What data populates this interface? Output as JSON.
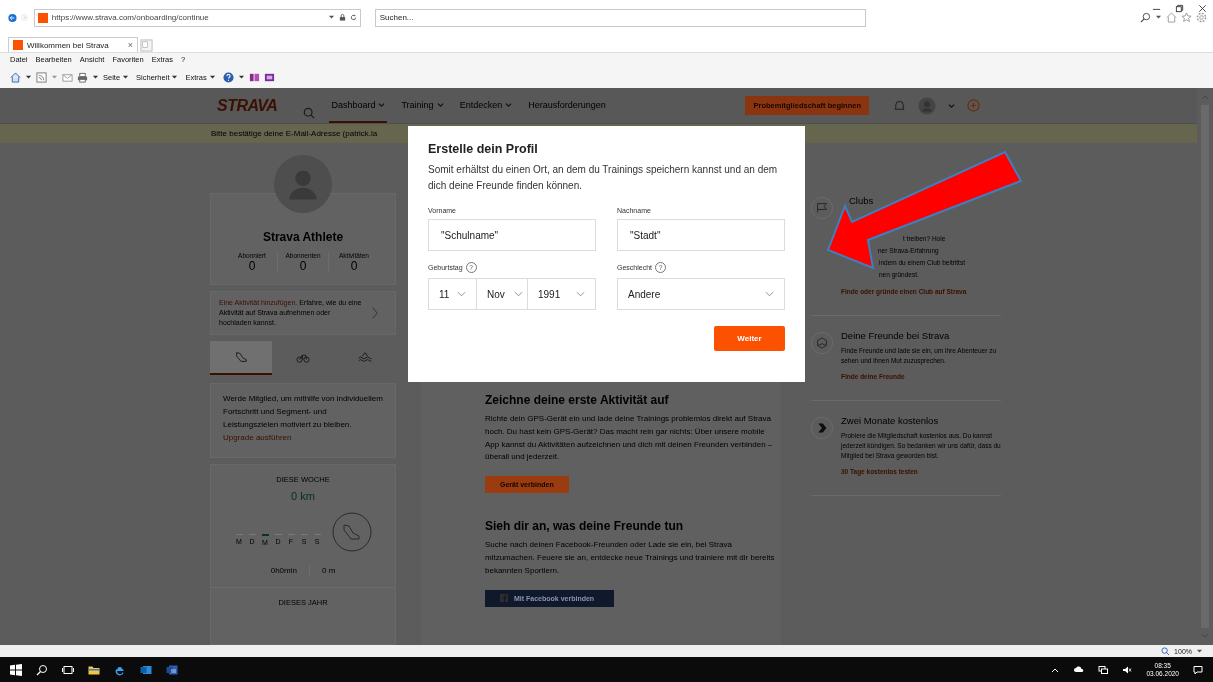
{
  "browser": {
    "address": "https://www.strava.com/onboarding/continue",
    "search_placeholder": "Suchen...",
    "tab": {
      "title": "Willkommen bei Strava",
      "close": "×"
    },
    "menu": [
      "Datei",
      "Bearbeiten",
      "Ansicht",
      "Favoriten",
      "Extras",
      "?"
    ],
    "commands": [
      "Seite",
      "Sicherheit",
      "Extras"
    ],
    "zoom": "100%"
  },
  "nav": {
    "logo": "STRAVA",
    "items": [
      {
        "label": "Dashboard",
        "has_menu": true,
        "selected": true
      },
      {
        "label": "Training",
        "has_menu": true,
        "selected": false
      },
      {
        "label": "Entdecken",
        "has_menu": true,
        "selected": false
      },
      {
        "label": "Herausforderungen",
        "has_menu": false,
        "selected": false
      }
    ],
    "trial_button": "Probemitgliedschaft beginnen"
  },
  "banner": "Bitte bestätige deine E-Mail-Adresse (patrick.la",
  "profile": {
    "name": "Strava Athlete",
    "stats": [
      {
        "label": "Abonniert",
        "value": "0"
      },
      {
        "label": "Abonnenten",
        "value": "0"
      },
      {
        "label": "Aktivitäten",
        "value": "0"
      }
    ]
  },
  "add_activity": {
    "link": "Eine Aktivität hinzufügen.",
    "text": "Erfahre, wie du eine Aktivität auf Strava aufnehmen oder hochladen kannst."
  },
  "sport_tabs": [
    {
      "kind": "run",
      "selected": true
    },
    {
      "kind": "ride",
      "selected": false
    },
    {
      "kind": "swim",
      "selected": false
    }
  ],
  "membership": {
    "text": "Werde Mitglied, um mithilfe von individuellem Fortschritt und Segment- und Leistungszielen motiviert zu bleiben.",
    "link": "Upgrade ausführen"
  },
  "week": {
    "heading": "DIESE WOCHE",
    "distance": "0 km",
    "days": [
      {
        "label": "M",
        "selected": false
      },
      {
        "label": "D",
        "selected": false
      },
      {
        "label": "M",
        "selected": true
      },
      {
        "label": "D",
        "selected": false
      },
      {
        "label": "F",
        "selected": false
      },
      {
        "label": "S",
        "selected": false
      },
      {
        "label": "S",
        "selected": false
      }
    ],
    "time": "0h0min",
    "elevation": "0 m",
    "year_heading": "DIESES JAHR"
  },
  "center": [
    {
      "title": "Zeichne deine erste Aktivität auf",
      "text": "Richte dein GPS-Gerät ein und lade deine Trainings problemlos direkt auf Strava hoch. Du hast kein GPS-Gerät? Das macht rein gar nichts: Über unsere mobile App kannst du Aktivitäten aufzeichnen und dich mit deinen Freunden verbinden – überall und jederzeit.",
      "button": {
        "kind": "device",
        "label": "Gerät verbinden"
      }
    },
    {
      "title": "Sieh dir an, was deine Freunde tun",
      "text": "Suche nach deinen Facebook-Freunden oder Lade sie ein, bei Strava mitzumachen. Feuere sie an, entdecke neue Trainings und trainiere mit dir bereits bekannten Sportlern.",
      "button": {
        "kind": "facebook",
        "label": "Mit Facebook verbinden"
      }
    }
  ],
  "right": [
    {
      "kind": "flag",
      "title": "Clubs",
      "lines": [
        "t treiben? Hole",
        "ner Strava-Erfahrung",
        "indem du einem Club beitrittst",
        "nen gründest."
      ],
      "link": "Finde oder gründe einen Club auf Strava"
    },
    {
      "kind": "friends",
      "title": "Deine Freunde bei Strava",
      "lines": [
        "Finde Freunde und lade sie ein, um ihre Abenteuer zu sehen und ihnen Mut zuzusprechen."
      ],
      "link": "Finde deine Freunde"
    },
    {
      "kind": "chevron",
      "title": "Zwei Monate kostenlos",
      "lines": [
        "Probiere die Mitgliedschaft kostenlos aus. Du kannst jederzeit kündigen. So bedanken wir uns dafür, dass du Mitglied bei Strava geworden bist."
      ],
      "link": "30 Tage kostenlos testen"
    }
  ],
  "modal": {
    "title": "Erstelle dein Profil",
    "text": "Somit erhältst du einen Ort, an dem du Trainings speichern kannst und an dem dich deine Freunde finden können.",
    "first_name": {
      "label": "Vorname",
      "value": "\"Schulname\""
    },
    "last_name": {
      "label": "Nachname",
      "value": "\"Stadt\""
    },
    "birthday": {
      "label": "Geburtstag",
      "help": "?",
      "day": "11",
      "month": "Nov",
      "year": "1991"
    },
    "gender": {
      "label": "Geschlecht",
      "help": "?",
      "value": "Andere"
    },
    "submit": "Weiter"
  },
  "taskbar": {
    "time": "08:35",
    "date": "03.06.2020"
  }
}
